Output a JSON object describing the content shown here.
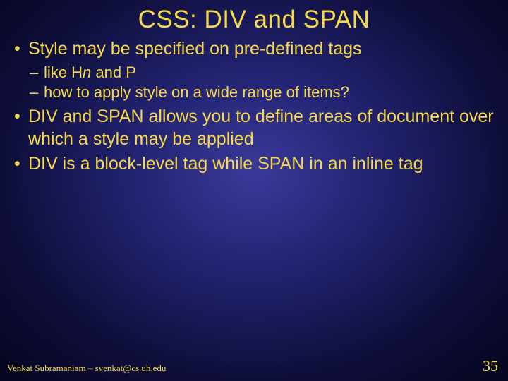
{
  "title": "CSS: DIV and SPAN",
  "bullets": {
    "b1": "Style may be specified on pre-defined tags",
    "b1_sub1_prefix": "like H",
    "b1_sub1_italic": "n",
    "b1_sub1_suffix": " and P",
    "b1_sub2": "how to apply style on a wide range of items?",
    "b2": "DIV and SPAN allows you to define areas of document over which a style may be applied",
    "b3": "DIV is a block-level tag while SPAN in an inline tag"
  },
  "footer": {
    "author": "Venkat Subramaniam – svenkat@cs.uh.edu",
    "page": "35"
  }
}
